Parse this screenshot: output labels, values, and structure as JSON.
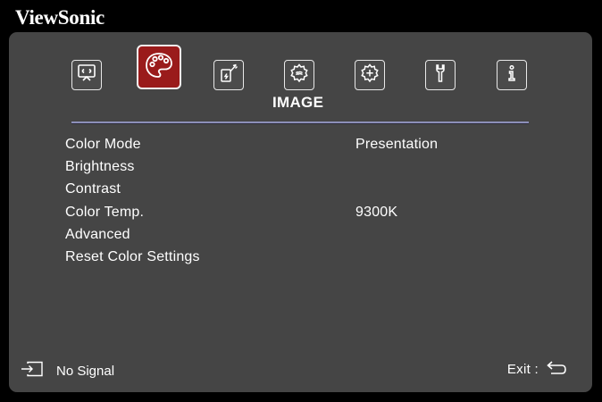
{
  "brand": {
    "name": "ViewSonic"
  },
  "tabs": [
    {
      "icon": "display-icon",
      "active": false
    },
    {
      "icon": "palette-icon",
      "active": true
    },
    {
      "icon": "power-plug-icon",
      "active": false
    },
    {
      "icon": "gear-icon",
      "active": false
    },
    {
      "icon": "gear-plus-icon",
      "active": false
    },
    {
      "icon": "wrench-icon",
      "active": false
    },
    {
      "icon": "info-icon",
      "active": false
    }
  ],
  "section_title": "IMAGE",
  "menu": {
    "items": [
      {
        "label": "Color Mode",
        "value": "Presentation"
      },
      {
        "label": "Brightness",
        "value": ""
      },
      {
        "label": "Contrast",
        "value": ""
      },
      {
        "label": "Color Temp.",
        "value": "9300K"
      },
      {
        "label": "Advanced",
        "value": ""
      },
      {
        "label": "Reset Color Settings",
        "value": ""
      }
    ]
  },
  "footer": {
    "source_status": "No Signal",
    "source_icon": "input-source-icon",
    "exit_label": "Exit :",
    "exit_icon": "return-icon"
  },
  "colors": {
    "panel_bg": "#454545",
    "active_tab": "#9a1b1b",
    "rule": "#8c8fb8",
    "text": "#ffffff"
  }
}
